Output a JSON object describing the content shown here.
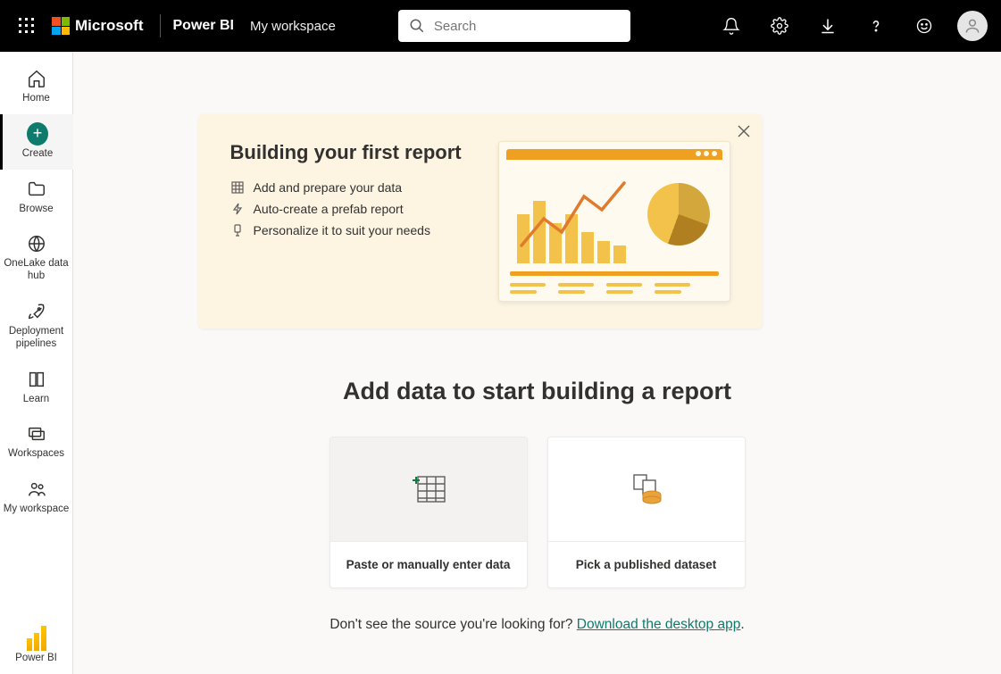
{
  "header": {
    "brand": "Microsoft",
    "product": "Power BI",
    "breadcrumb": "My workspace",
    "search_placeholder": "Search"
  },
  "sidebar": {
    "items": [
      {
        "label": "Home"
      },
      {
        "label": "Create"
      },
      {
        "label": "Browse"
      },
      {
        "label": "OneLake data hub"
      },
      {
        "label": "Deployment pipelines"
      },
      {
        "label": "Learn"
      },
      {
        "label": "Workspaces"
      },
      {
        "label": "My workspace"
      }
    ],
    "footer": {
      "label": "Power BI"
    }
  },
  "banner": {
    "title": "Building your first report",
    "steps": [
      "Add and prepare your data",
      "Auto-create a prefab report",
      "Personalize it to suit your needs"
    ]
  },
  "main": {
    "heading": "Add data to start building a report",
    "cards": [
      {
        "label": "Paste or manually enter data"
      },
      {
        "label": "Pick a published dataset"
      }
    ],
    "footer_prompt": "Don't see the source you're looking for?  ",
    "footer_link": "Download the desktop app",
    "footer_period": "."
  }
}
